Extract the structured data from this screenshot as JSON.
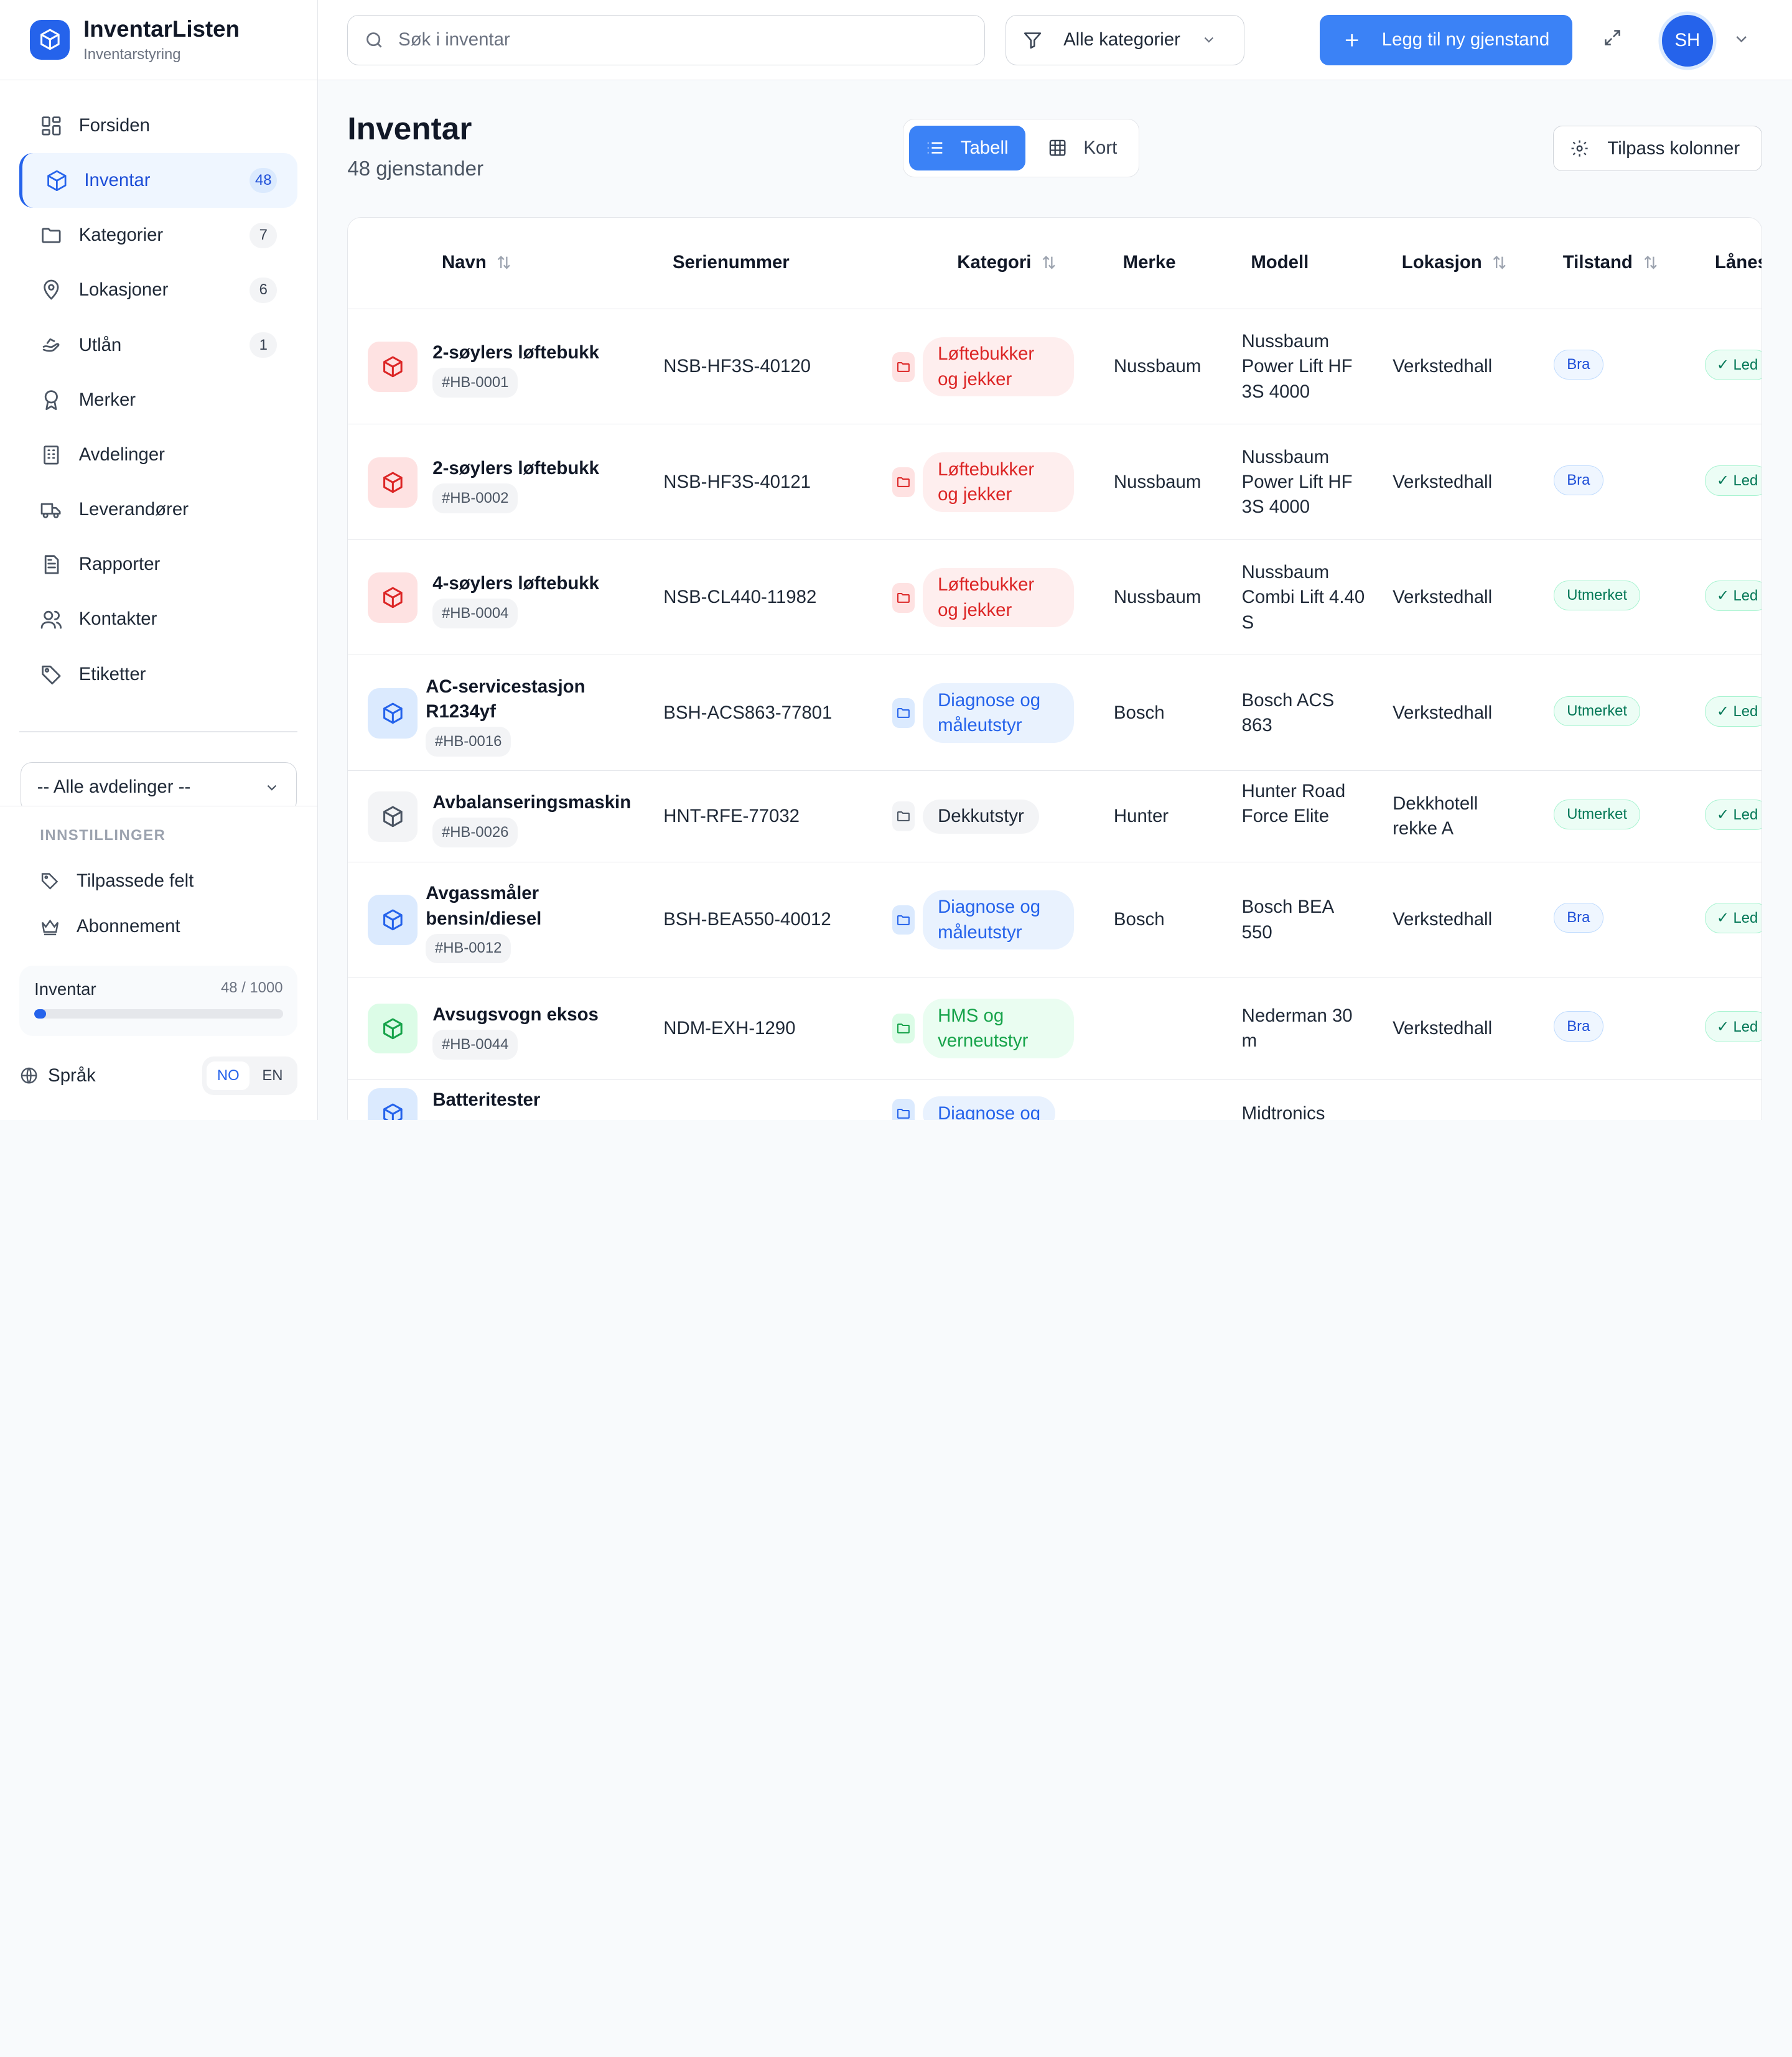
{
  "brand": {
    "title": "InventarListen",
    "subtitle": "Inventarstyring",
    "accent": "#2563eb"
  },
  "sidebar": {
    "items": [
      {
        "label": "Forsiden",
        "icon": "dashboard-icon",
        "badge": ""
      },
      {
        "label": "Inventar",
        "icon": "box-icon",
        "badge": "48",
        "active": true
      },
      {
        "label": "Kategorier",
        "icon": "folder-icon",
        "badge": "7"
      },
      {
        "label": "Lokasjoner",
        "icon": "map-pin-icon",
        "badge": "6"
      },
      {
        "label": "Utlån",
        "icon": "hand-icon",
        "badge": "1"
      },
      {
        "label": "Merker",
        "icon": "award-icon",
        "badge": ""
      },
      {
        "label": "Avdelinger",
        "icon": "building-icon",
        "badge": ""
      },
      {
        "label": "Leverandører",
        "icon": "truck-icon",
        "badge": ""
      },
      {
        "label": "Rapporter",
        "icon": "report-icon",
        "badge": ""
      },
      {
        "label": "Kontakter",
        "icon": "users-icon",
        "badge": ""
      },
      {
        "label": "Etiketter",
        "icon": "tag-icon",
        "badge": ""
      }
    ],
    "department_select": "-- Alle avdelinger --",
    "settings_heading": "INNSTILLINGER",
    "settings_items": [
      {
        "label": "Tilpassede felt",
        "icon": "tags-icon"
      },
      {
        "label": "Abonnement",
        "icon": "crown-icon"
      }
    ],
    "usage": {
      "label": "Inventar",
      "count": "48 / 1000",
      "fraction": 0.048
    },
    "language": {
      "label": "Språk",
      "options": [
        "NO",
        "EN"
      ],
      "selected": "NO"
    }
  },
  "topbar": {
    "search_placeholder": "Søk i inventar",
    "category_filter": "Alle kategorier",
    "add_button": "Legg til ny gjenstand",
    "avatar_initials": "SH"
  },
  "page": {
    "title": "Inventar",
    "count": "48 gjenstander",
    "view_toggle": {
      "table": "Tabell",
      "cards": "Kort",
      "selected": "Tabell"
    },
    "columns_button": "Tilpass kolonner"
  },
  "table": {
    "headers": [
      "Navn",
      "Serienummer",
      "Kategori",
      "Merke",
      "Modell",
      "Lokasjon",
      "Tilstand",
      "Lånes"
    ],
    "rows": [
      {
        "name": "2-søylers løftebukk",
        "id": "#HB-0001",
        "serial": "NSB-HF3S-40120",
        "category": "Løftebukker og jekker",
        "cat_color": "red",
        "brand": "Nussbaum",
        "model": "Nussbaum Power Lift HF 3S 4000",
        "location": "Verkstedhall",
        "condition": "Bra",
        "loan": "Led"
      },
      {
        "name": "2-søylers løftebukk",
        "id": "#HB-0002",
        "serial": "NSB-HF3S-40121",
        "category": "Løftebukker og jekker",
        "cat_color": "red",
        "brand": "Nussbaum",
        "model": "Nussbaum Power Lift HF 3S 4000",
        "location": "Verkstedhall",
        "condition": "Bra",
        "loan": "Led"
      },
      {
        "name": "4-søylers løftebukk",
        "id": "#HB-0004",
        "serial": "NSB-CL440-11982",
        "category": "Løftebukker og jekker",
        "cat_color": "red",
        "brand": "Nussbaum",
        "model": "Nussbaum Combi Lift 4.40 S",
        "location": "Verkstedhall",
        "condition": "Utmerket",
        "loan": "Led"
      },
      {
        "name": "AC-servicestasjon R1234yf",
        "id": "#HB-0016",
        "serial": "BSH-ACS863-77801",
        "category": "Diagnose og måleutstyr",
        "cat_color": "blue",
        "brand": "Bosch",
        "model": "Bosch ACS 863",
        "location": "Verkstedhall",
        "condition": "Utmerket",
        "loan": "Led"
      },
      {
        "name": "Avbalanseringsmaskin",
        "id": "#HB-0026",
        "serial": "HNT-RFE-77032",
        "category": "Dekkutstyr",
        "cat_color": "gray",
        "brand": "Hunter",
        "model": "Hunter Road Force Elite",
        "location": "Dekkhotell rekke A",
        "condition": "Utmerket",
        "loan": "Led"
      },
      {
        "name": "Avgassmåler bensin/diesel",
        "id": "#HB-0012",
        "serial": "BSH-BEA550-40012",
        "category": "Diagnose og måleutstyr",
        "cat_color": "blue",
        "brand": "Bosch",
        "model": "Bosch BEA 550",
        "location": "Verkstedhall",
        "condition": "Bra",
        "loan": "Led"
      },
      {
        "name": "Avsugsvogn eksos",
        "id": "#HB-0044",
        "serial": "NDM-EXH-1290",
        "category": "HMS og verneutstyr",
        "cat_color": "green",
        "brand": "",
        "model": "Nederman 30 m",
        "location": "Verkstedhall",
        "condition": "Bra",
        "loan": "Led"
      },
      {
        "name": "Batteritester",
        "id": "",
        "serial": "",
        "category": "Diagnose og",
        "cat_color": "blue",
        "brand": "",
        "model": "Midtronics",
        "location": "",
        "condition": "",
        "loan": ""
      }
    ]
  },
  "colors": {
    "red_bg": "#fee2e2",
    "red_fg": "#dc2626",
    "blue_bg": "#dbeafe",
    "blue_fg": "#2563eb",
    "green_bg": "#dcfce7",
    "green_fg": "#16a34a",
    "gray_bg": "#f3f4f6",
    "gray_fg": "#4b5563",
    "primary": "#3b82f6"
  }
}
